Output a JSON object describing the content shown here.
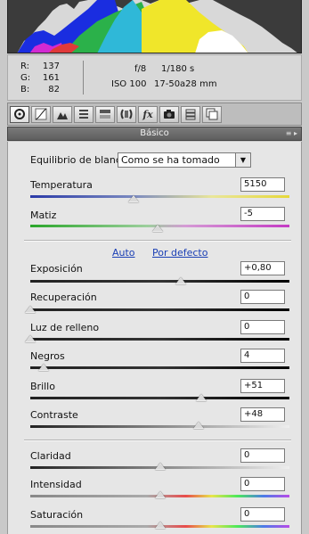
{
  "info": {
    "r_label": "R:",
    "r_value": "137",
    "g_label": "G:",
    "g_value": "161",
    "b_label": "B:",
    "b_value": "82",
    "aperture": "f/8",
    "shutter": "1/180 s",
    "iso": "ISO 100",
    "lens": "17-50a28 mm"
  },
  "toolbar": {
    "tools": [
      "basic-tool-icon",
      "tone-curve-icon",
      "detail-icon",
      "hsl-icon",
      "split-toning-icon",
      "lens-corrections-icon",
      "effects-icon",
      "camera-calibration-icon",
      "presets-icon",
      "snapshots-icon"
    ],
    "fx_label": "fx"
  },
  "section": {
    "title": "Básico",
    "menu_glyph": "≡ ▸"
  },
  "white_balance": {
    "label": "Equilibrio de blancos:",
    "value": "Como se ha tomado",
    "arrow": "▼"
  },
  "sliders": {
    "temperatura": {
      "label": "Temperatura",
      "value": "5150",
      "level": 0.4
    },
    "matiz": {
      "label": "Matiz",
      "value": "-5",
      "level": 0.49
    },
    "exposicion": {
      "label": "Exposición",
      "value": "+0,80",
      "level": 0.58
    },
    "recuperacion": {
      "label": "Recuperación",
      "value": "0",
      "level": 0.0
    },
    "luz_relleno": {
      "label": "Luz de relleno",
      "value": "0",
      "level": 0.0
    },
    "negros": {
      "label": "Negros",
      "value": "4",
      "level": 0.05
    },
    "brillo": {
      "label": "Brillo",
      "value": "+51",
      "level": 0.66
    },
    "contraste": {
      "label": "Contraste",
      "value": "+48",
      "level": 0.65
    },
    "claridad": {
      "label": "Claridad",
      "value": "0",
      "level": 0.5
    },
    "intensidad": {
      "label": "Intensidad",
      "value": "0",
      "level": 0.5
    },
    "saturacion": {
      "label": "Saturación",
      "value": "0",
      "level": 0.5
    }
  },
  "auto_link": "Auto",
  "default_link": "Por defecto",
  "colors": {
    "panel_bg": "#e6e6e6",
    "header_bg": "#5e5e5e",
    "link": "#1a3fb5"
  }
}
